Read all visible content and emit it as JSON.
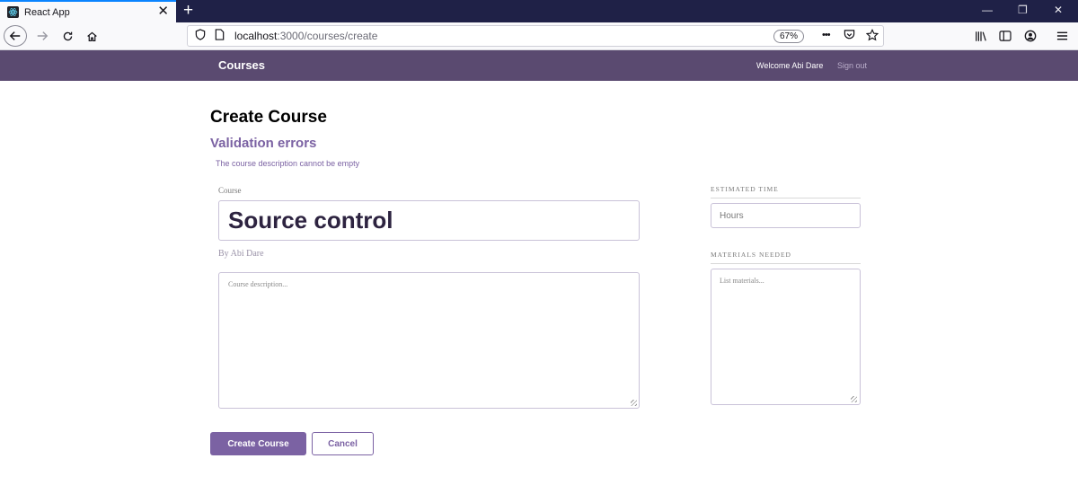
{
  "browser": {
    "tab_title": "React App",
    "tab_close": "✕",
    "new_tab": "+",
    "url_host": "localhost",
    "url_rest": ":3000/courses/create",
    "zoom": "67%",
    "more_icon": "•••",
    "window_controls": {
      "minimize": "—",
      "restore": "❐",
      "close": "✕"
    }
  },
  "header": {
    "brand": "Courses",
    "welcome": "Welcome Abi Dare",
    "sign_out": "Sign out"
  },
  "form": {
    "page_title": "Create Course",
    "validation_title": "Validation errors",
    "validation_errors": [
      "The course description cannot be empty"
    ],
    "course_label": "Course",
    "course_title_value": "Source control",
    "byline": "By Abi Dare",
    "description_placeholder": "Course description...",
    "estimated_time_label": "ESTIMATED TIME",
    "hours_placeholder": "Hours",
    "materials_label": "MATERIALS NEEDED",
    "materials_placeholder": "List materials...",
    "submit_label": "Create Course",
    "cancel_label": "Cancel"
  },
  "colors": {
    "header_bg": "#5a4a70",
    "accent": "#7b62a3",
    "tabstrip_bg": "#1f2147"
  }
}
